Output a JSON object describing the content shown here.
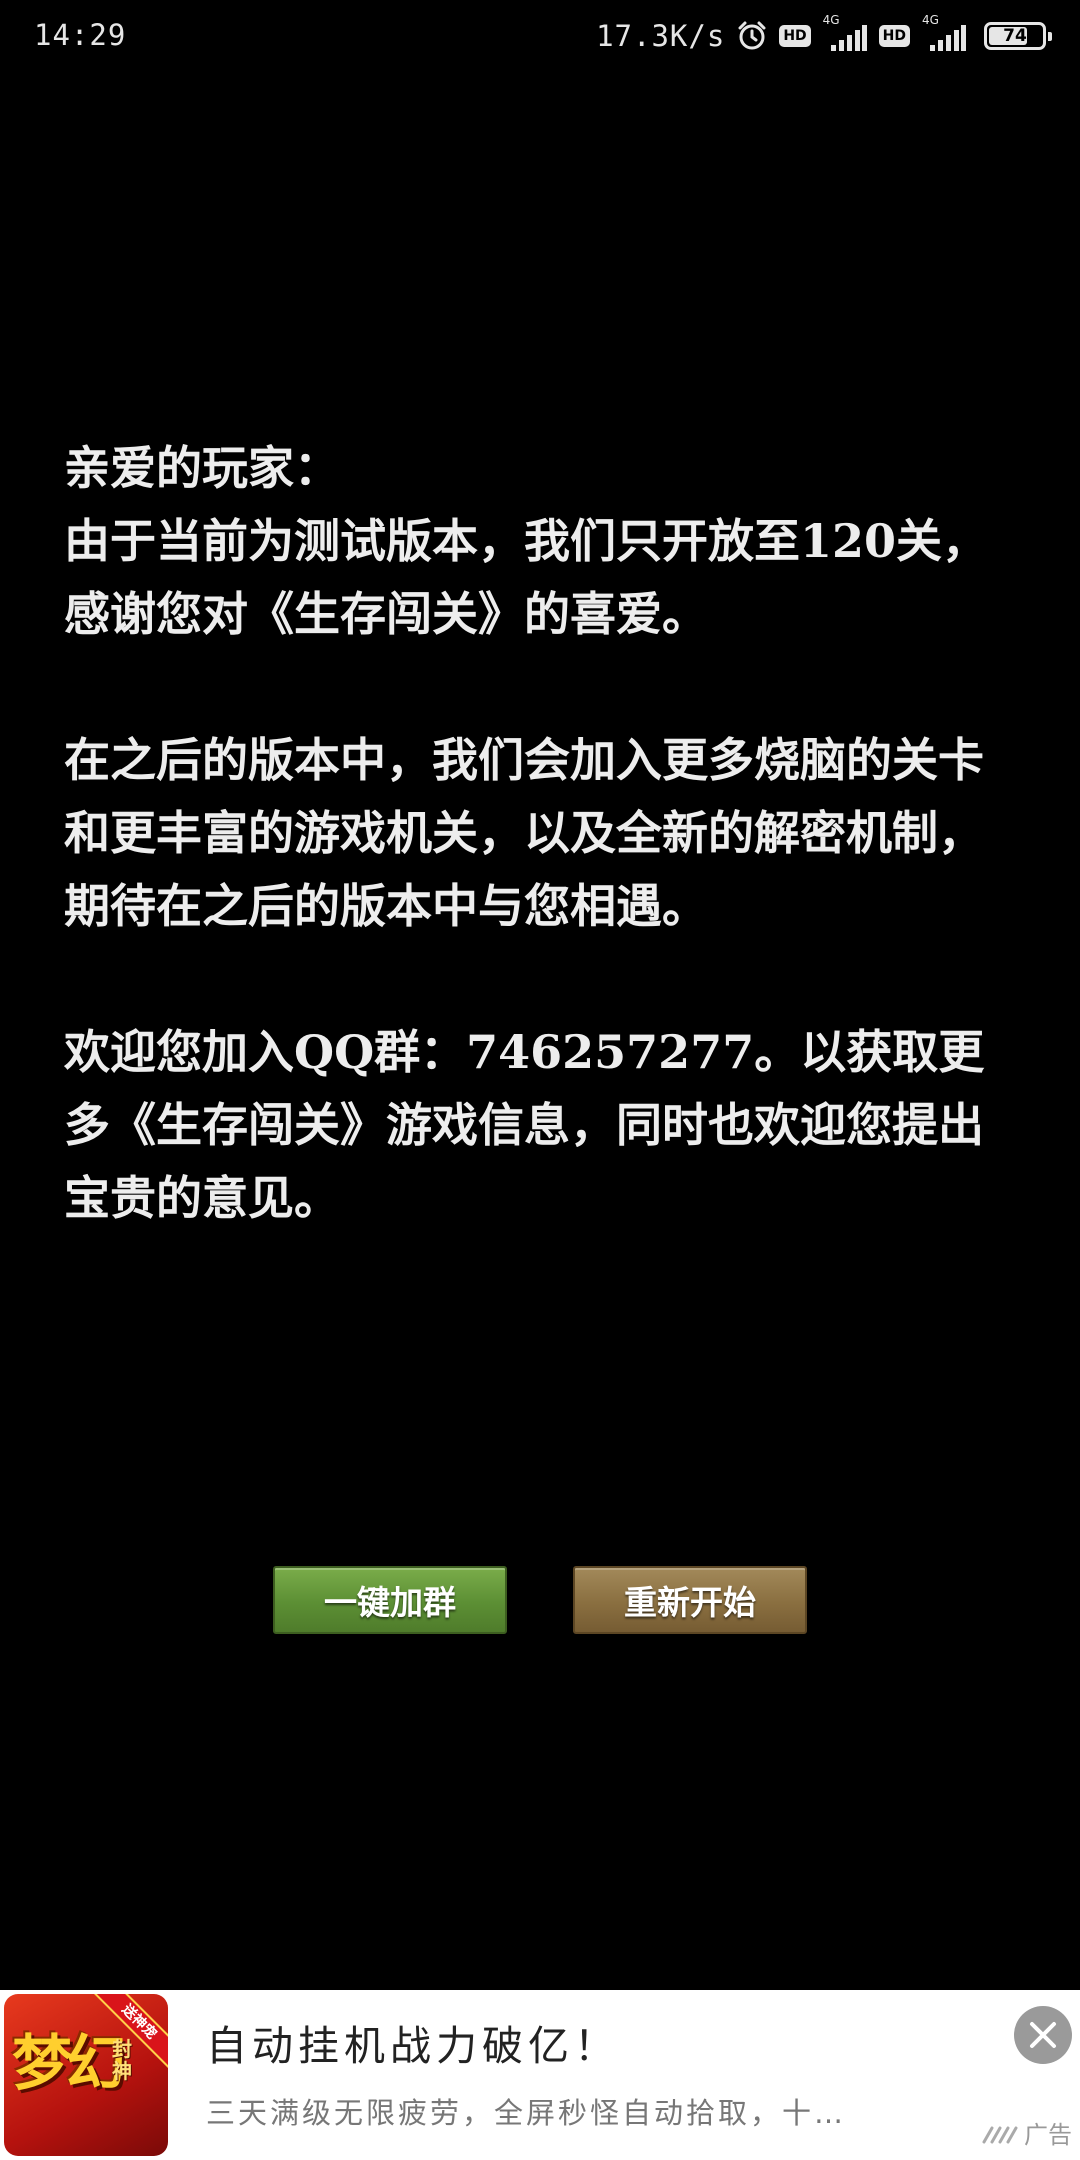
{
  "status_bar": {
    "time": "14:29",
    "net_speed": "17.3K/s",
    "hd_badge_1": "HD",
    "net_type_1": "4G",
    "hd_badge_2": "HD",
    "net_type_2": "4G",
    "battery_level": "74",
    "battery_fraction": 0.74
  },
  "message": {
    "greeting": "亲爱的玩家：",
    "para1": "由于当前为测试版本，我们只开放至120关，感谢您对《生存闯关》的喜爱。",
    "para2": "在之后的版本中，我们会加入更多烧脑的关卡和更丰富的游戏机关，以及全新的解密机制，期待在之后的版本中与您相遇。",
    "para3": "欢迎您加入QQ群：746257277。以获取更多《生存闯关》游戏信息，同时也欢迎您提出宝贵的意见。"
  },
  "buttons": {
    "join_group": "一键加群",
    "restart": "重新开始"
  },
  "ad": {
    "app_ribbon": "送神宠",
    "app_logo_main": "梦幻",
    "app_logo_sub": "封神",
    "title": "自动挂机战力破亿！",
    "description": "三天满级无限疲劳，全屏秒怪自动拾取，十…",
    "label": "广告"
  },
  "colors": {
    "background": "#000000",
    "text": "#ededed",
    "join_button": "#5c8f34",
    "restart_button": "#8a6f40",
    "ad_background": "#ffffff"
  }
}
